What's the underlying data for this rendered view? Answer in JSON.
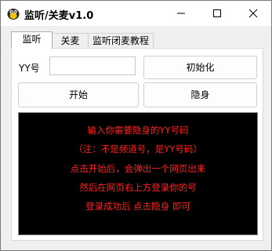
{
  "window": {
    "title": "监听/关麦v1.0"
  },
  "tabs": [
    {
      "label": "监听",
      "active": true
    },
    {
      "label": "关麦",
      "active": false
    },
    {
      "label": "监听闭麦教程",
      "active": false
    }
  ],
  "form": {
    "yy_label": "YY号",
    "yy_value": "",
    "init_button": "初始化",
    "start_button": "开始",
    "hide_button": "隐身"
  },
  "console": {
    "text_color": "#ff2020",
    "lines": [
      "输入你需要隐身的YY号码",
      "（注：不是频道号，是YY号码）",
      "点击开始后，会弹出一个网页出来",
      "然后在网页右上方登录你的号",
      "登录成功后 点击隐身 即可"
    ]
  }
}
